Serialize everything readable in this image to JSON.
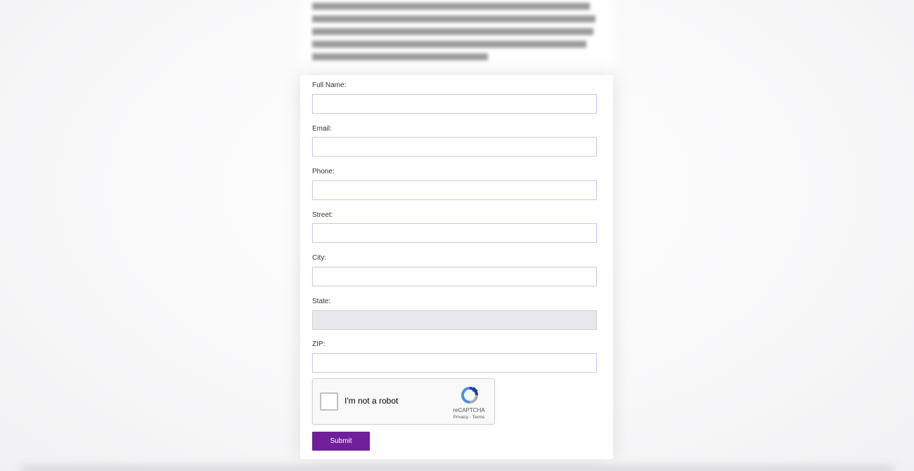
{
  "form": {
    "fields": [
      {
        "label": "Full Name:",
        "value": ""
      },
      {
        "label": "Email:",
        "value": ""
      },
      {
        "label": "Phone:",
        "value": ""
      },
      {
        "label": "Street:",
        "value": ""
      },
      {
        "label": "City:",
        "value": ""
      },
      {
        "label": "State:",
        "value": "",
        "disabled": true
      },
      {
        "label": "ZIP:",
        "value": ""
      }
    ],
    "submit_label": "Submit"
  },
  "recaptcha": {
    "checkbox_label": "I'm not a robot",
    "brand": "reCAPTCHA",
    "links": "Privacy - Terms",
    "icon": "recaptcha-logo-icon"
  },
  "colors": {
    "submit_bg": "#6f1f9a",
    "input_border": "#c9c8ea",
    "disabled_bg": "#e8e9ec"
  }
}
